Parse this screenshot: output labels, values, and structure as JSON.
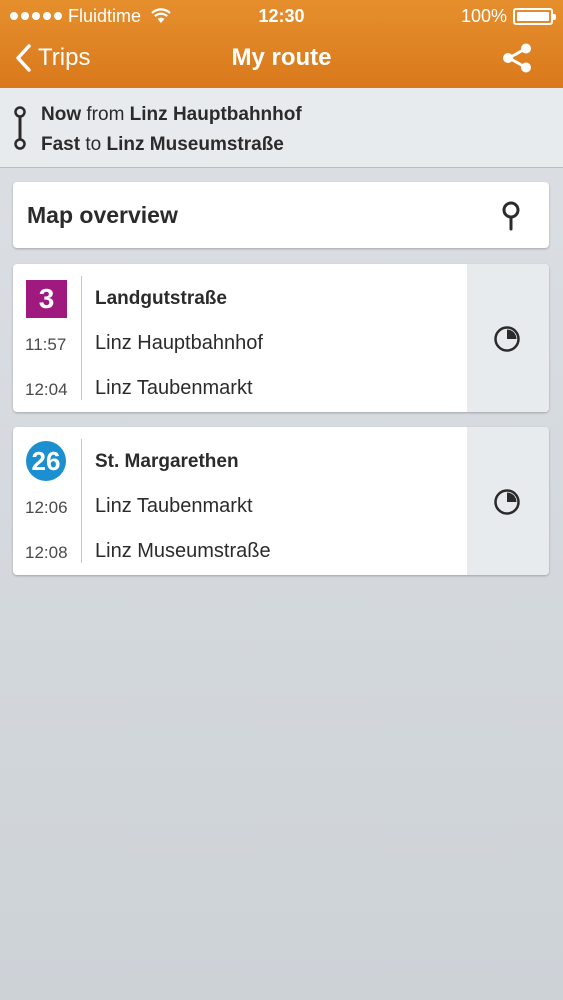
{
  "status_bar": {
    "carrier": "Fluidtime",
    "time": "12:30",
    "battery": "100%"
  },
  "nav": {
    "back_label": "Trips",
    "title": "My route"
  },
  "summary": {
    "line1": {
      "when": "Now",
      "connector": "from",
      "place": "Linz Hauptbahnhof"
    },
    "line2": {
      "mode": "Fast",
      "connector": "to",
      "place": "Linz Museumstraße"
    }
  },
  "map_overview": {
    "label": "Map overview"
  },
  "legs": [
    {
      "line": "3",
      "line_color": "#a0197f",
      "badge_shape": "square",
      "destination": "Landgutstraße",
      "departure": {
        "time": "11:57",
        "stop": "Linz Hauptbahnhof"
      },
      "arrival": {
        "time": "12:04",
        "stop": "Linz Taubenmarkt"
      }
    },
    {
      "line": "26",
      "line_color": "#1b8fd0",
      "badge_shape": "circle",
      "destination": "St. Margarethen",
      "departure": {
        "time": "12:06",
        "stop": "Linz Taubenmarkt"
      },
      "arrival": {
        "time": "12:08",
        "stop": "Linz Museumstraße"
      }
    }
  ],
  "colors": {
    "header": "#d9791c",
    "background": "#d3d7db"
  }
}
